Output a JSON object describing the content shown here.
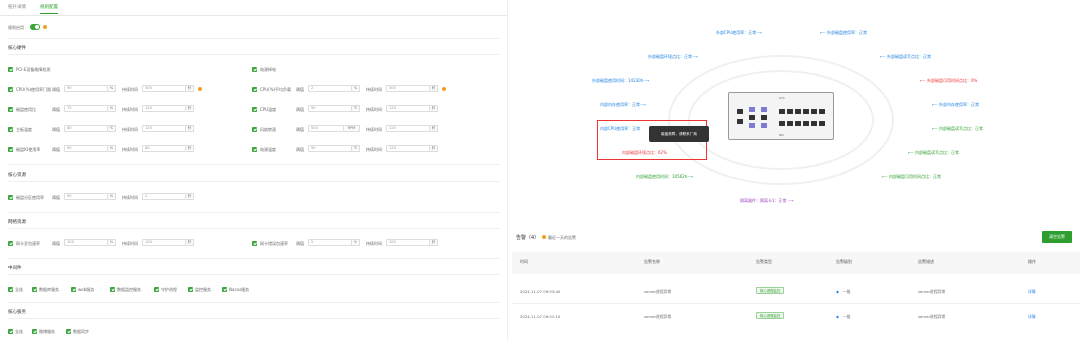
{
  "tabs": [
    "拓扑详情",
    "规则配置"
  ],
  "enable_label": "规则启用",
  "sections": {
    "core": "核心硬件",
    "core_sub": "核心资源",
    "net": "网络资源",
    "midware": "中间件",
    "biz": "核心服务"
  },
  "fields": {
    "r1a": "PCI-E设备故障检测",
    "r1b": "电源掉电",
    "r2a": "CPU(%)使用率门限",
    "r2b": "CPU(%)平均负载",
    "r3a": "磁盘使用比",
    "r3b": "CPU温度",
    "r4a": "主板温度",
    "r4b": "风扇转速",
    "r5a": "磁盘IO使用率",
    "r5b": "电源温度",
    "r6a": "磁盘分区使用率",
    "r7a": "网卡丢包速率",
    "r7b": "网卡错误包速率",
    "threshold": "阈值",
    "duration": "持续时间",
    "v1": "90",
    "v2": "75",
    "v3": "80",
    "v4": "300",
    "v5": "2",
    "v6": "100",
    "v7": "5",
    "v8": "120",
    "v9": "500",
    "u_pct": "%",
    "u_c": "℃",
    "u_s": "秒",
    "u_rpm": "RPM"
  },
  "mid": [
    "全选",
    "数据库服务",
    "web服务",
    "数据监控服务",
    "守护进程",
    "监控服务",
    "Nacos服务"
  ],
  "biz": [
    "全选",
    "微博服务",
    "数据同步"
  ],
  "topo": {
    "t1": "外部CPU使用率：正常⟶",
    "t2": "⟵ 外部磁盘使用率：正常",
    "t3": "外部磁盘环境点比：正常⟶",
    "t4": "⟵ 外部磁盘读写点比：正常",
    "t5": "外部磁盘使用时间：14230h⟶",
    "t6": "⟵ 外部磁盘可用时间点比：0%",
    "t7": "内部内存使用率：正常⟶",
    "t8": "⟵ 外部内存使用率：正常",
    "t9": "内部CPU使用率：正常",
    "t10": "⟵ 内部磁盘读写点比：正常",
    "t11": "内部磁盘环境点比：62%",
    "t12": "⟵ 内部磁盘读写点比：正常",
    "t13": "内部磁盘使用时间：10562h⟶",
    "t14": "⟵ 内部磁盘可用时间点比：正常",
    "t15": "隔离器件：隔离卡1：正常 ⟶",
    "tooltip": "磁盘故障，请联系厂商",
    "dev_top": "SYS",
    "dev_bot": "NIC"
  },
  "alarm": {
    "title": "告警（4）",
    "note": "最近一天的告警",
    "clear": "清空告警"
  },
  "columns": [
    "时间",
    "告警名称",
    "告警类型",
    "告警级别",
    "告警描述",
    "操作"
  ],
  "rows": [
    {
      "time": "2024-11-07 09:53:40",
      "name": "server进程异常",
      "type": "核心进程监控",
      "level": "一般",
      "desc": "server进程异常",
      "op": "详情"
    },
    {
      "time": "2024-11-07 09:51:10",
      "name": "server进程异常",
      "type": "核心进程监控",
      "level": "一般",
      "desc": "server进程异常",
      "op": "详情"
    }
  ]
}
